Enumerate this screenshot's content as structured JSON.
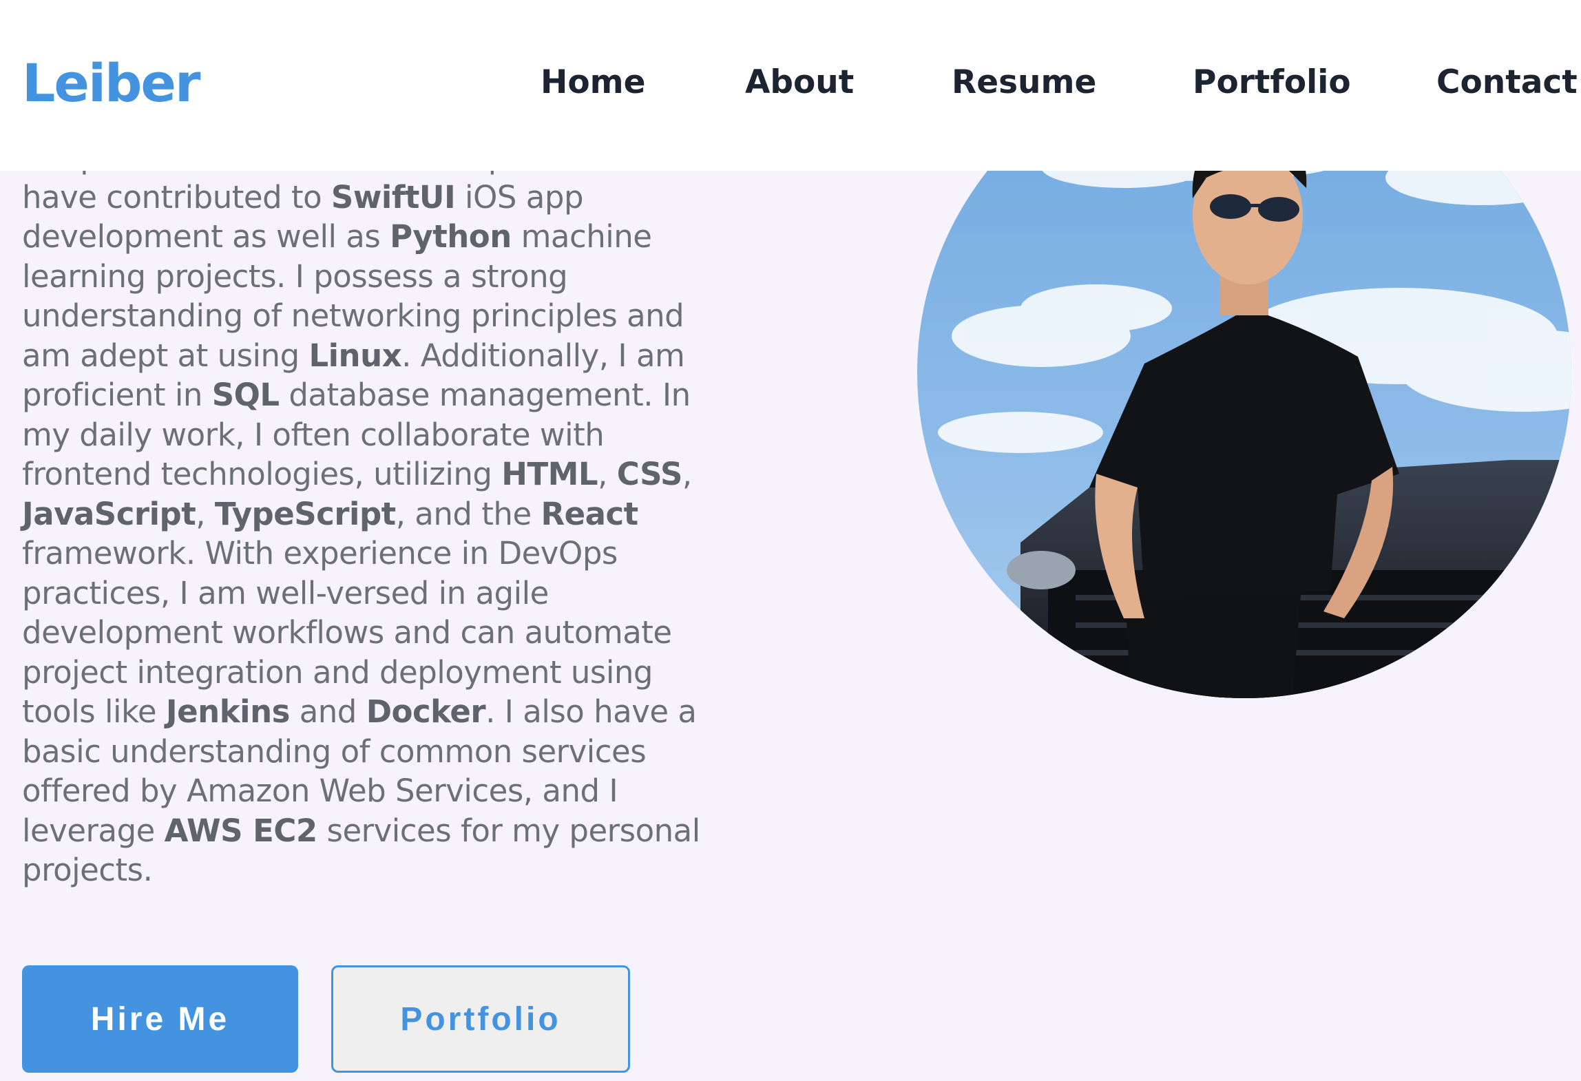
{
  "header": {
    "logo": "Leiber",
    "nav": {
      "home": "Home",
      "about": "About",
      "resume": "Resume",
      "portfolio": "Portfolio",
      "contact": "Contact"
    }
  },
  "intro": {
    "lines": [
      [
        "am proficient in ",
        {
          "b": "C/C++"
        },
        " development and"
      ],
      [
        "have contributed to ",
        {
          "b": "SwiftUI"
        },
        " iOS app"
      ],
      [
        "development as well as ",
        {
          "b": "Python"
        },
        " machine"
      ],
      [
        "learning projects. I possess a strong"
      ],
      [
        "understanding of networking principles and"
      ],
      [
        "am adept at using ",
        {
          "b": "Linux"
        },
        ". Additionally, I am"
      ],
      [
        "proficient in ",
        {
          "b": "SQL"
        },
        " database management. In"
      ],
      [
        "my daily work, I often collaborate with"
      ],
      [
        "frontend technologies, utilizing ",
        {
          "b": "HTML"
        },
        ", ",
        {
          "b": "CSS"
        },
        ","
      ],
      [
        {
          "b": "JavaScript"
        },
        ", ",
        {
          "b": "TypeScript"
        },
        ", and the ",
        {
          "b": "React"
        }
      ],
      [
        "framework. With experience in DevOps"
      ],
      [
        "practices, I am well-versed in agile"
      ],
      [
        "development workflows and can automate"
      ],
      [
        "project integration and deployment using"
      ],
      [
        "tools like ",
        {
          "b": "Jenkins"
        },
        " and ",
        {
          "b": "Docker"
        },
        ". I also have a"
      ],
      [
        "basic understanding of common services"
      ],
      [
        "offered by Amazon Web Services, and I"
      ],
      [
        "leverage ",
        {
          "b": "AWS EC2"
        },
        " services for my personal"
      ],
      [
        "projects."
      ]
    ],
    "buttons": {
      "hire": "Hire Me",
      "portfolio": "Portfolio"
    }
  },
  "colors": {
    "accent": "#4393e0",
    "nav_text": "#1d2431",
    "body_text": "#6c6f78",
    "page_bg": "#f6f3fc",
    "header_bg": "#ffffff"
  },
  "icons": {
    "portrait": "profile-photo"
  }
}
